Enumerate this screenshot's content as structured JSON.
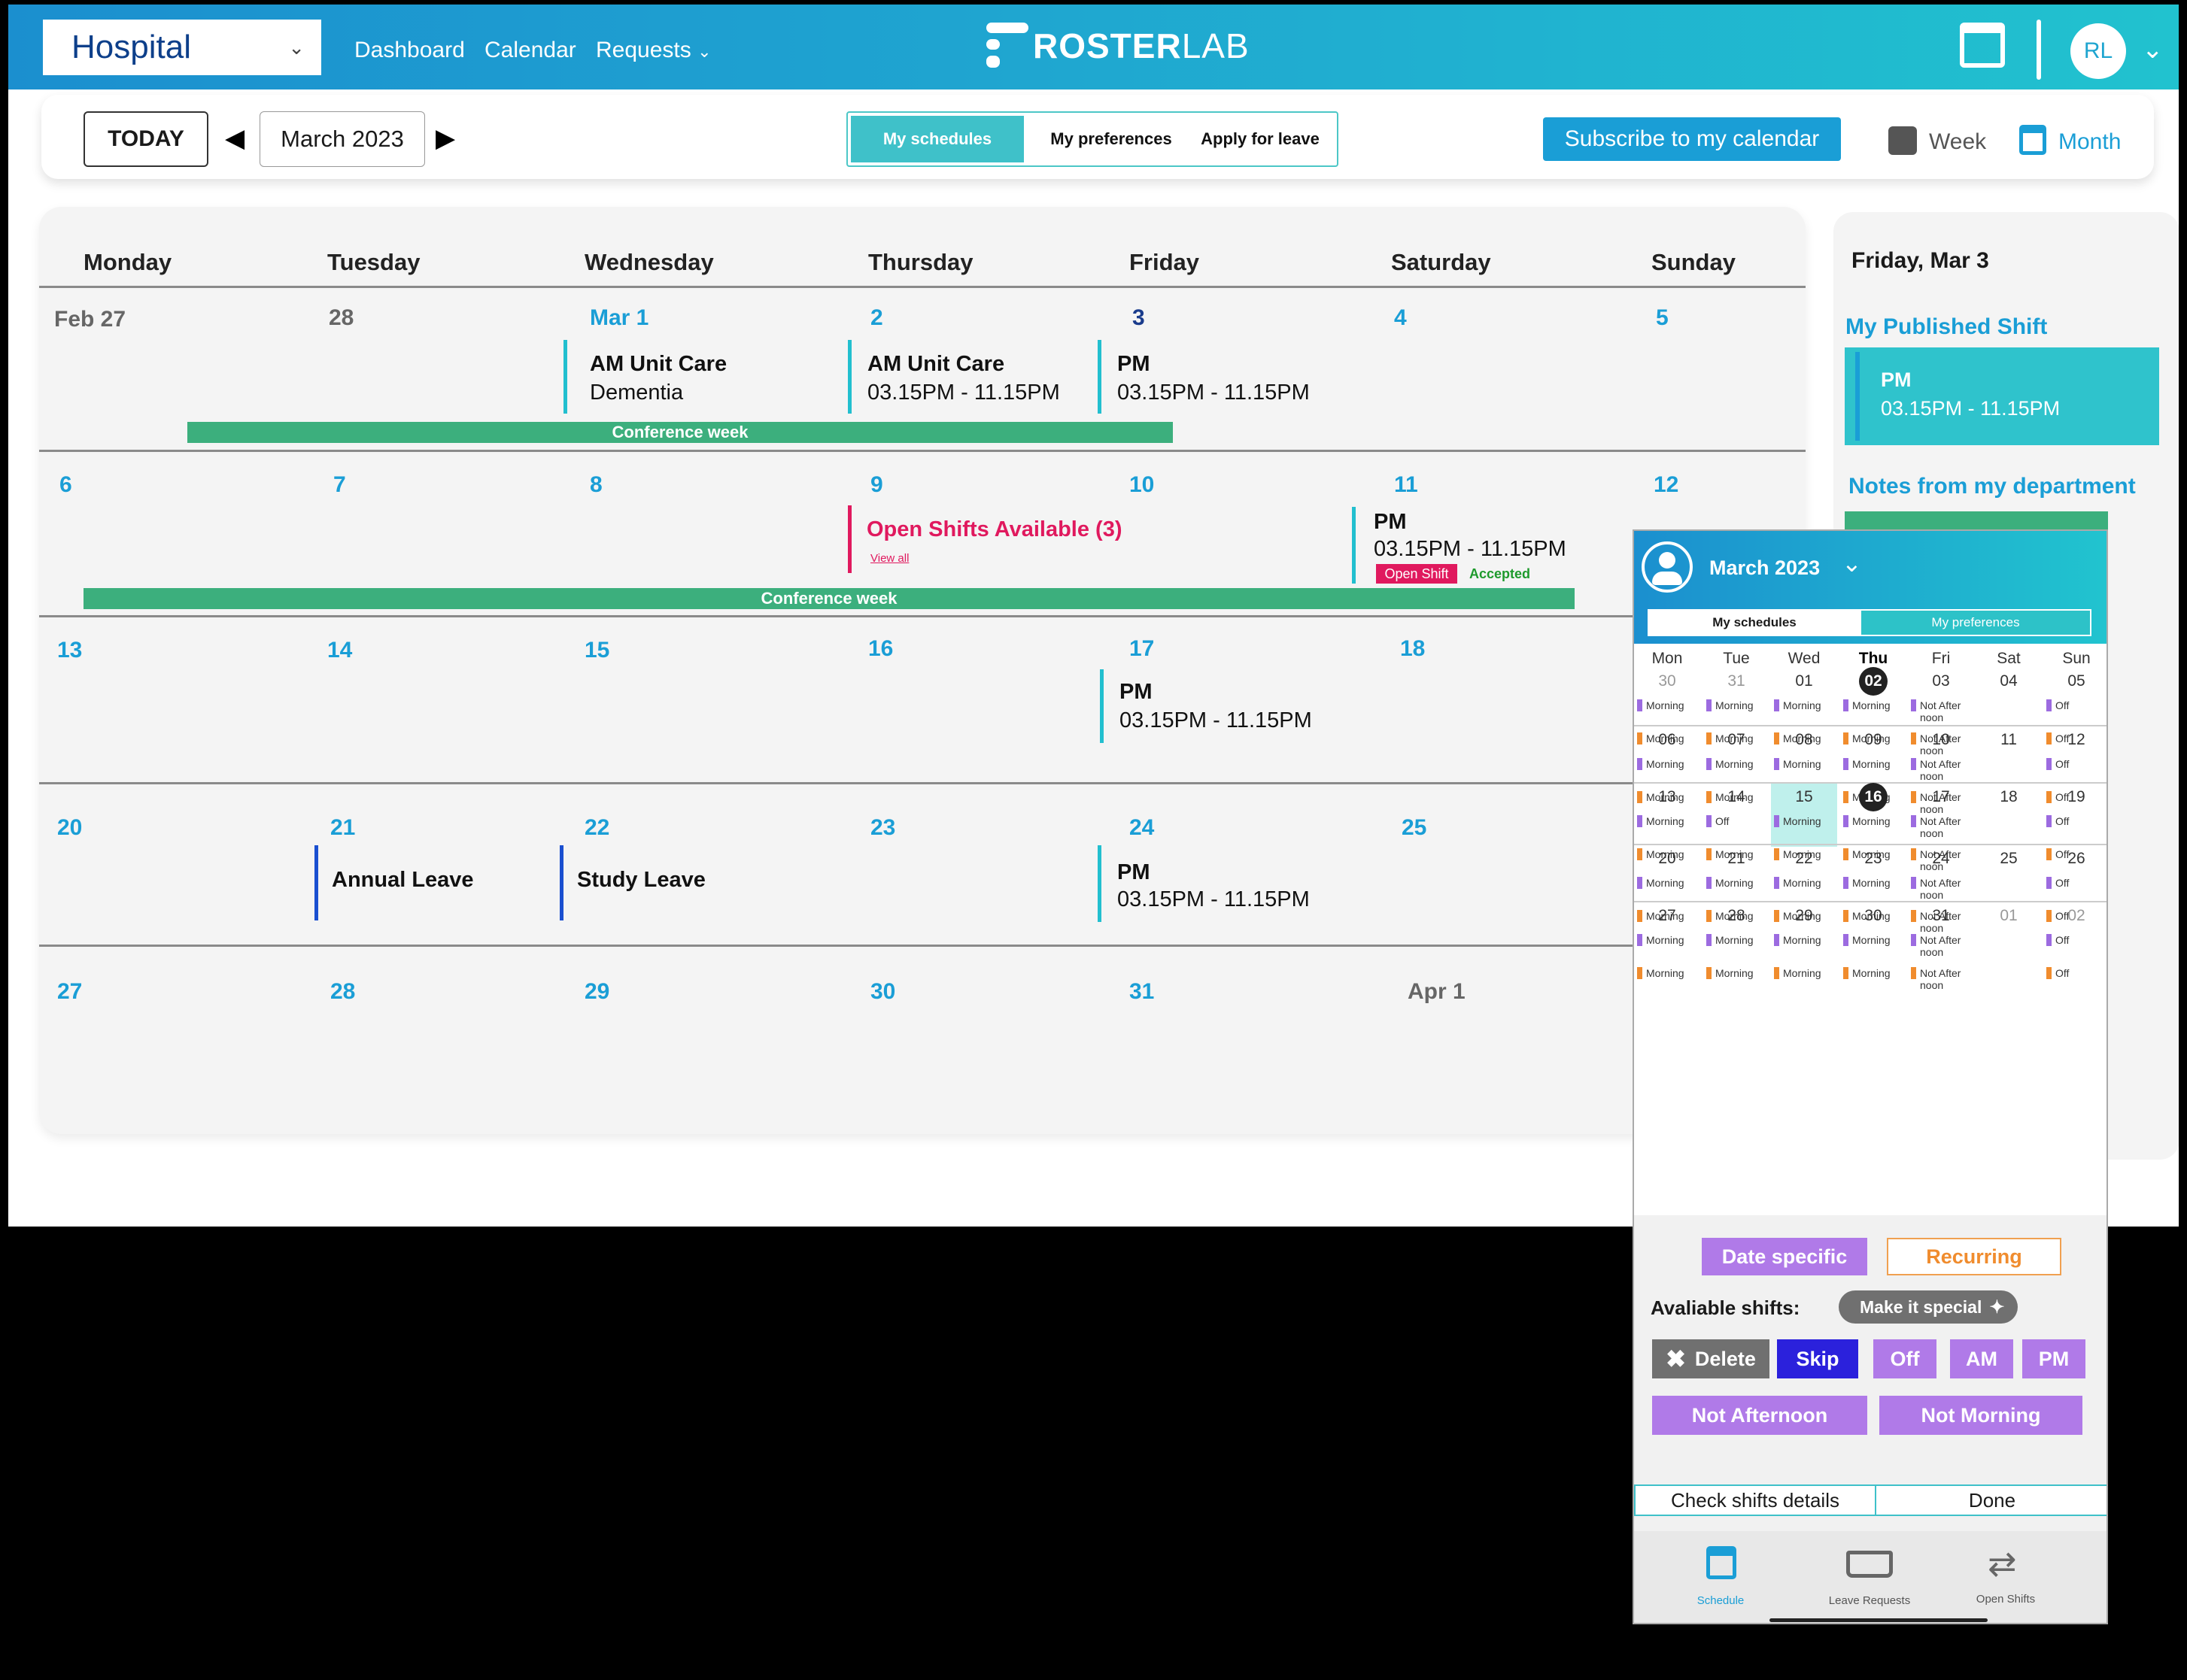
{
  "header": {
    "org_select": "Hospital",
    "nav": [
      "Dashboard",
      "Calendar",
      "Requests"
    ],
    "logo_bold": "ROSTER",
    "logo_light": "LAB",
    "avatar_initials": "RL"
  },
  "toolbar": {
    "today": "TODAY",
    "month": "March 2023",
    "tabs": [
      "My schedules",
      "My preferences",
      "Apply for leave"
    ],
    "subscribe": "Subscribe to my calendar",
    "view_week": "Week",
    "view_month": "Month"
  },
  "calendar": {
    "weekdays": [
      "Monday",
      "Tuesday",
      "Wednesday",
      "Thursday",
      "Friday",
      "Saturday",
      "Sunday"
    ],
    "weeks": [
      [
        "Feb 27",
        "28",
        "Mar 1",
        "2",
        "3",
        "4",
        "5"
      ],
      [
        "6",
        "7",
        "8",
        "9",
        "10",
        "11",
        "12"
      ],
      [
        "13",
        "14",
        "15",
        "16",
        "17",
        "18",
        ""
      ],
      [
        "20",
        "21",
        "22",
        "23",
        "24",
        "25",
        ""
      ],
      [
        "27",
        "28",
        "29",
        "30",
        "31",
        "Apr 1",
        ""
      ]
    ],
    "events": {
      "w1_wed_title": "AM Unit Care",
      "w1_wed_sub": "Dementia",
      "w1_thu_title": "AM Unit Care",
      "w1_thu_time": "03.15PM - 11.15PM",
      "w1_fri_title": "PM",
      "w1_fri_time": "03.15PM - 11.15PM",
      "w2_thu_open": "Open Shifts Available (3)",
      "w2_thu_link": "View all",
      "w2_sat_title": "PM",
      "w2_sat_time": "03.15PM - 11.15PM",
      "w2_sat_badge": "Open Shift",
      "w2_sat_status": "Accepted",
      "w3_fri_title": "PM",
      "w3_fri_time": "03.15PM - 11.15PM",
      "w4_tue": "Annual Leave",
      "w4_wed": "Study Leave",
      "w4_fri_title": "PM",
      "w4_fri_time": "03.15PM - 11.15PM"
    },
    "conference_label": "Conference week"
  },
  "side": {
    "date": "Friday, Mar 3",
    "published_title": "My Published Shift",
    "shift_title": "PM",
    "shift_time": "03.15PM - 11.15PM",
    "notes_title": "Notes from my department"
  },
  "phone": {
    "month": "March 2023",
    "tabs": [
      "My schedules",
      "My preferences"
    ],
    "weekdays": [
      "Mon",
      "Tue",
      "Wed",
      "Thu",
      "Fri",
      "Sat",
      "Sun"
    ],
    "weeks": [
      {
        "dates": [
          "30",
          "31",
          "01",
          "02",
          "03",
          "04",
          "05"
        ],
        "r1": [
          "Morning",
          "Morning",
          "Morning",
          "Morning",
          "Not After noon",
          "",
          "Off"
        ],
        "r2": [
          "Morning",
          "Morning",
          "Morning",
          "Morning",
          "Not After noon",
          "",
          "Off"
        ]
      },
      {
        "dates": [
          "06",
          "07",
          "08",
          "09",
          "10",
          "11",
          "12"
        ],
        "r1": [
          "Morning",
          "Morning",
          "Morning",
          "Morning",
          "Not After noon",
          "",
          "Off"
        ],
        "r2": [
          "Morning",
          "Morning",
          "Morning",
          "Morning",
          "Not After noon",
          "",
          "Off"
        ]
      },
      {
        "dates": [
          "13",
          "14",
          "15",
          "16",
          "17",
          "18",
          "19"
        ],
        "r1": [
          "Morning",
          "Off",
          "Morning",
          "Morning",
          "Not After noon",
          "",
          "Off"
        ],
        "r2": [
          "Morning",
          "Morning",
          "Morning",
          "Morning",
          "Not After noon",
          "",
          "Off"
        ]
      },
      {
        "dates": [
          "20",
          "21",
          "22",
          "23",
          "24",
          "25",
          "26"
        ],
        "r1": [
          "Morning",
          "Morning",
          "Morning",
          "Morning",
          "Not After noon",
          "",
          "Off"
        ],
        "r2": [
          "Morning",
          "Morning",
          "Morning",
          "Morning",
          "Not After noon",
          "",
          "Off"
        ]
      },
      {
        "dates": [
          "27",
          "28",
          "29",
          "30",
          "31",
          "01",
          "02"
        ],
        "r1": [
          "Morning",
          "Morning",
          "Morning",
          "Morning",
          "Not After noon",
          "",
          "Off"
        ],
        "r2": [
          "Morning",
          "Morning",
          "Morning",
          "Morning",
          "Not After noon",
          "",
          "Off"
        ]
      }
    ],
    "date_specific": "Date specific",
    "recurring": "Recurring",
    "available_label": "Avaliable shifts:",
    "make_special": "Make it special",
    "shift_buttons": [
      "Delete",
      "Skip",
      "Off",
      "AM",
      "PM"
    ],
    "shift_buttons2": [
      "Not Afternoon",
      "Not Morning"
    ],
    "check_details": "Check shifts details",
    "done": "Done",
    "bottom_tabs": [
      "Schedule",
      "Leave Requests",
      "Open Shifts"
    ]
  },
  "colors": {
    "accent": "#1a9ed6",
    "teal": "#22bfcf",
    "conference": "#3caf7d",
    "preference_morning": "#9c6be0",
    "preference_alt": "#f08c2e",
    "open_shift": "#e0195e",
    "shift_button": "#b07ae8"
  }
}
